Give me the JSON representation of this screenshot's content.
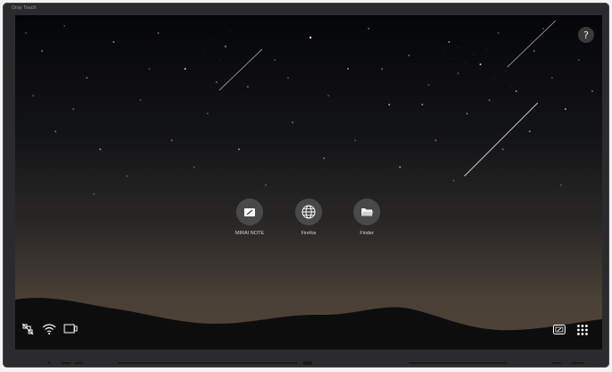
{
  "device": {
    "brand": "Oray Touch"
  },
  "help": {
    "label": "?"
  },
  "apps": [
    {
      "id": "mirai-note",
      "label": "MIRAI NOTE",
      "icon": "note-pen-icon"
    },
    {
      "id": "firefox",
      "label": "Firefox",
      "icon": "globe-icon"
    },
    {
      "id": "finder",
      "label": "Finder",
      "icon": "folder-icon"
    }
  ],
  "status": {
    "icons": [
      "network-disconnected-icon",
      "wifi-icon",
      "display-input-icon"
    ]
  },
  "tray": {
    "icons": [
      "screen-share-icon",
      "app-grid-icon"
    ]
  },
  "colors": {
    "icon_bg": "#505050",
    "label": "#d8d8d8"
  }
}
